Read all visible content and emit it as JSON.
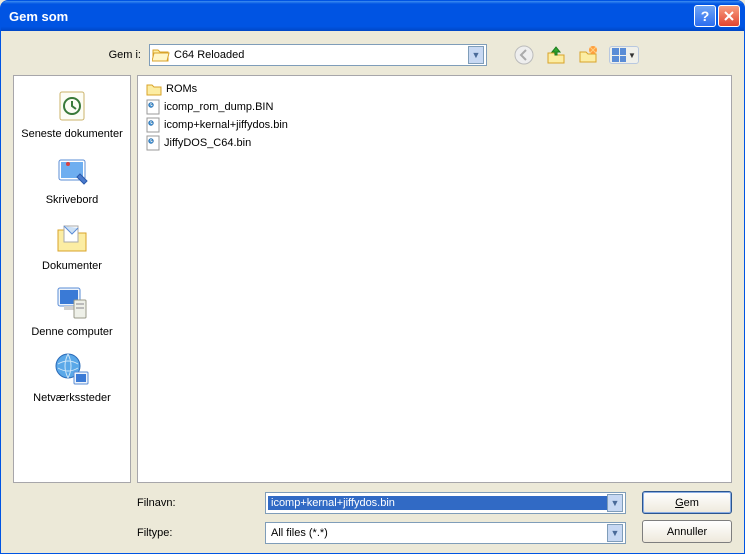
{
  "title": "Gem som",
  "lookin_label": "Gem i:",
  "lookin_value": "C64 Reloaded",
  "places": [
    {
      "label": "Seneste dokumenter",
      "icon": "recent"
    },
    {
      "label": "Skrivebord",
      "icon": "desktop"
    },
    {
      "label": "Dokumenter",
      "icon": "documents"
    },
    {
      "label": "Denne computer",
      "icon": "computer"
    },
    {
      "label": "Netværkssteder",
      "icon": "network"
    }
  ],
  "files": [
    {
      "name": "ROMs",
      "type": "folder"
    },
    {
      "name": "icomp_rom_dump.BIN",
      "type": "file"
    },
    {
      "name": "icomp+kernal+jiffydos.bin",
      "type": "file"
    },
    {
      "name": "JiffyDOS_C64.bin",
      "type": "file"
    }
  ],
  "filename_label": "Filnavn:",
  "filename_value": "icomp+kernal+jiffydos.bin",
  "filetype_label": "Filtype:",
  "filetype_value": "All files (*.*)",
  "save_label": "Gem",
  "cancel_label": "Annuller"
}
